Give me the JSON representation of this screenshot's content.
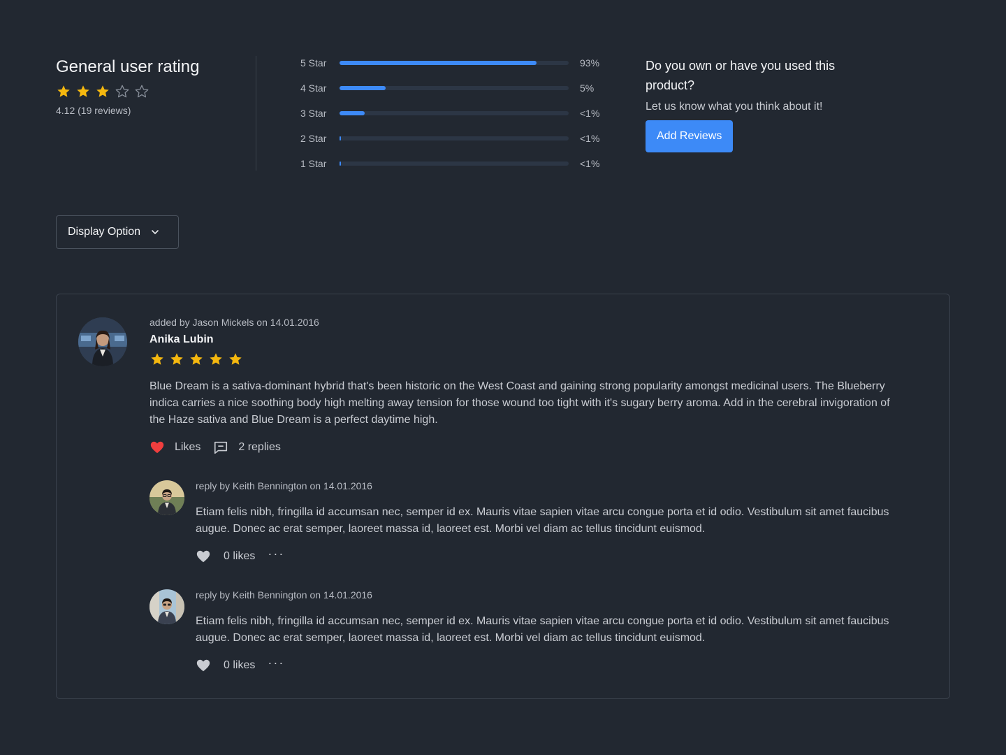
{
  "summary": {
    "title": "General user rating",
    "rating": 3,
    "max_rating": 5,
    "meta": "4.12 (19 reviews)"
  },
  "distribution": [
    {
      "label": "5 Star",
      "percent_text": "93%",
      "fill": 0.86
    },
    {
      "label": "4 Star",
      "percent_text": "5%",
      "fill": 0.2
    },
    {
      "label": "3 Star",
      "percent_text": "<1%",
      "fill": 0.11
    },
    {
      "label": "2 Star",
      "percent_text": "<1%",
      "fill": 0.006
    },
    {
      "label": "1 Star",
      "percent_text": "<1%",
      "fill": 0.006
    }
  ],
  "cta": {
    "question": "Do you own or have you used this product?",
    "prompt": "Let us know what you think about it!",
    "button_label": "Add Reviews"
  },
  "display_option": {
    "label": "Display Option"
  },
  "review": {
    "added_by": "added by Jason Mickels on 14.01.2016",
    "author": "Anika Lubin",
    "rating": 5,
    "text": "Blue Dream is a sativa-dominant hybrid that's been historic on the West Coast and gaining strong popularity amongst medicinal users. The Blueberry indica carries a nice soothing body high melting away tension for those wound too tight with it's sugary berry aroma. Add in the cerebral invigoration of the Haze sativa and Blue Dream is a perfect daytime high.",
    "likes_label": "Likes",
    "replies_label": "2 replies",
    "replies": [
      {
        "meta": "reply by Keith Bennington on 14.01.2016",
        "text": "Etiam felis nibh, fringilla id accumsan nec, semper id ex. Mauris vitae sapien vitae arcu congue porta et id odio. Vestibulum sit amet faucibus augue. Donec ac erat semper, laoreet massa id, laoreet est. Morbi vel diam ac tellus tincidunt euismod.",
        "likes_label": "0 likes",
        "more_label": "···"
      },
      {
        "meta": "reply by Keith Bennington on 14.01.2016",
        "text": "Etiam felis nibh, fringilla id accumsan nec, semper id ex. Mauris vitae sapien vitae arcu congue porta et id odio. Vestibulum sit amet faucibus augue. Donec ac erat semper, laoreet massa id, laoreet est. Morbi vel diam ac tellus tincidunt euismod.",
        "likes_label": "0 likes",
        "more_label": "···"
      }
    ]
  },
  "colors": {
    "background": "#222831",
    "accent": "#3d8af7",
    "star_filled": "#f5b80f",
    "heart_liked": "#f03e3e",
    "heart_unliked": "#c9ccd2"
  },
  "icons": {
    "star": "star-icon",
    "chevron": "chevron-down-icon",
    "heart": "heart-icon",
    "comment": "comment-icon",
    "more": "more-icon"
  }
}
